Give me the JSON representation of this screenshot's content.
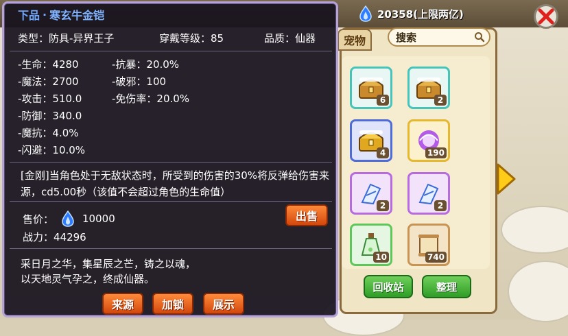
{
  "currency": {
    "amount_text": "20358(上限两亿)",
    "icon": "blue-flame-gem-icon"
  },
  "close_icon": "close-x-icon",
  "bag": {
    "tab_label": "宠物",
    "search_label": "搜索",
    "search_icon": "magnifier-icon",
    "slots": [
      {
        "icon": "treasure-chest-icon",
        "count": "6"
      },
      {
        "icon": "treasure-chest-icon",
        "count": "2"
      },
      {
        "icon": "gold-treasure-chest-icon",
        "count": "4"
      },
      {
        "icon": "purple-orb-icon",
        "count": "190"
      },
      {
        "icon": "crystal-shard-icon",
        "count": "2"
      },
      {
        "icon": "crystal-shard-icon",
        "count": "2"
      },
      {
        "icon": "potion-bottle-icon",
        "count": "10"
      },
      {
        "icon": "scroll-icon",
        "count": "740"
      }
    ],
    "recycle_label": "回收站",
    "sort_label": "整理",
    "next_icon": "arrow-right-icon"
  },
  "tooltip": {
    "grade": "下品",
    "separator": "·",
    "name": "寒玄牛金铠",
    "type_text": "类型：防具-异界王子",
    "level_text": "穿戴等级：85",
    "quality_text": "品质：仙器",
    "stats_left": [
      "-生命：4280",
      "-魔法：2700",
      "-攻击：510.0",
      "-防御：340.0",
      "-魔抗：4.0%",
      "-闪避：10.0%"
    ],
    "stats_right": [
      "-抗暴：20.0%",
      "-破邪：100",
      "-免伤率：20.0%"
    ],
    "skill_text": "[金刚]当角色处于无敌状态时，所受到的伤害的30%将反弹给伤害来源，cd5.00秒（该值不会超过角色的生命值）",
    "price_label": "售价：",
    "price_value": "10000",
    "power_text": "战力：44296",
    "sell_label": "出售",
    "desc_line1": "采日月之华，集星辰之芒，铸之以魂，",
    "desc_line2": "以天地灵气孕之，终成仙器。",
    "btn_source": "来源",
    "btn_lock": "加锁",
    "btn_show": "展示"
  }
}
